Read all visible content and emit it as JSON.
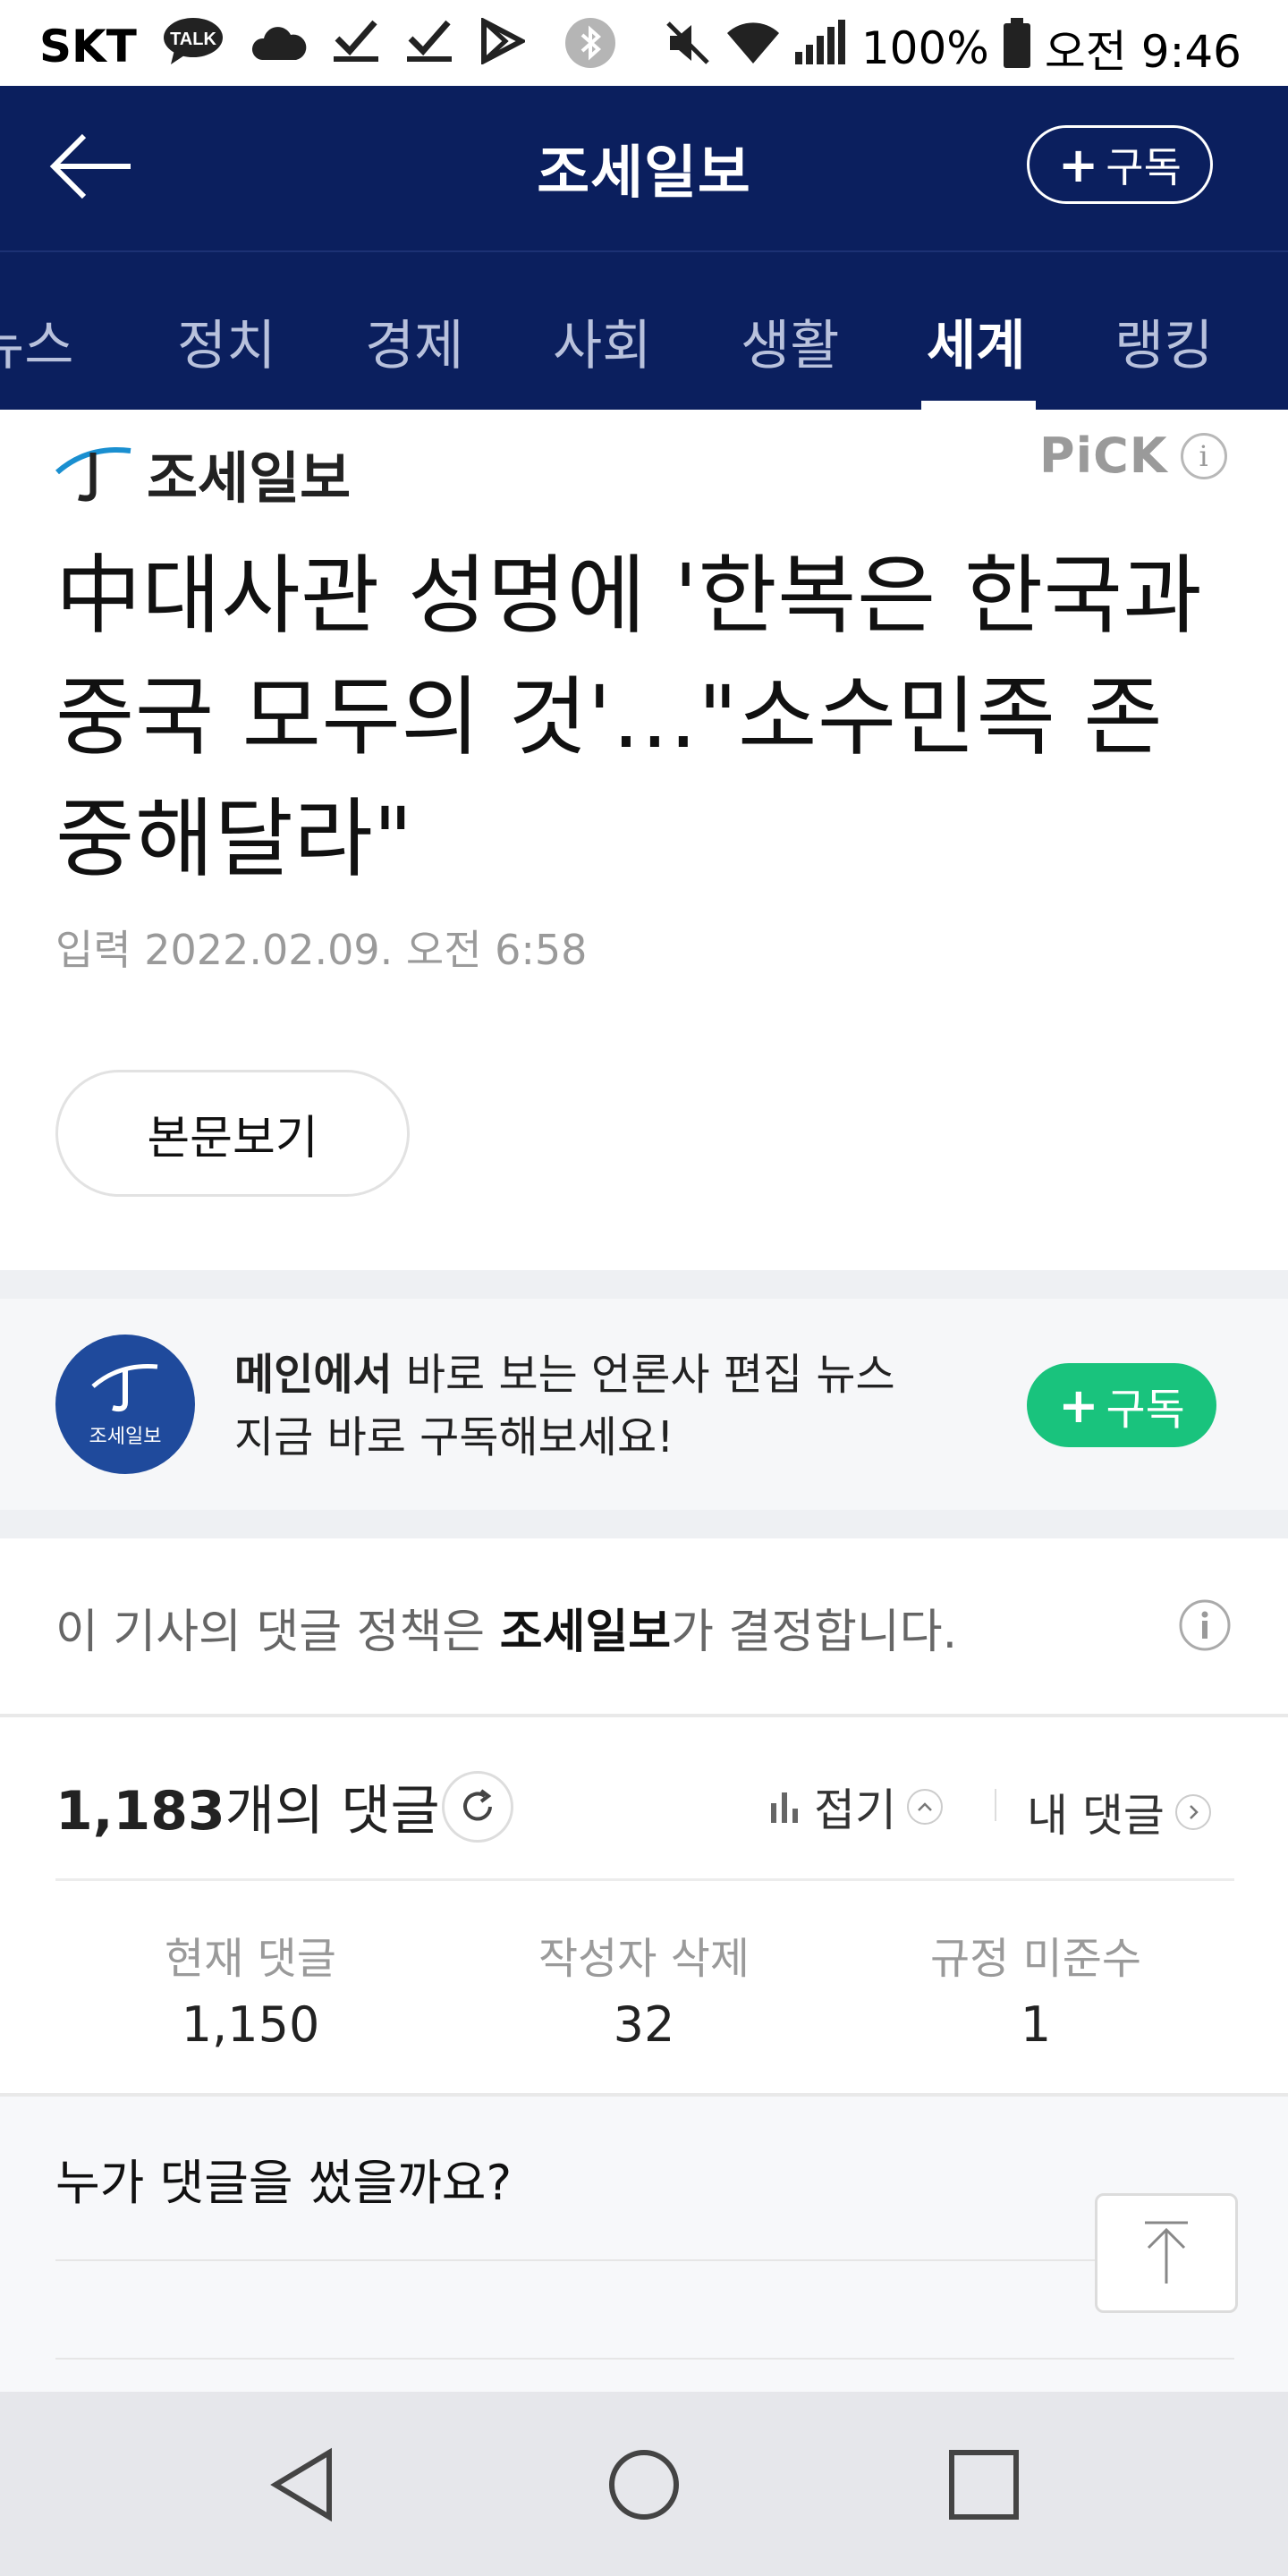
{
  "status_bar": {
    "carrier": "SKT",
    "talk_badge": "TALK",
    "battery": "100%",
    "time": "오전 9:46",
    "icons": [
      "kakaotalk-icon",
      "cloud-icon",
      "check-icon",
      "check-icon",
      "play-store-icon",
      "bluetooth-icon",
      "mute-icon",
      "wifi-icon",
      "signal-icon",
      "battery-icon"
    ]
  },
  "header": {
    "title": "조세일보",
    "subscribe_label": "구독",
    "back_icon": "arrow-left-icon"
  },
  "tabs": [
    {
      "label": "뉴스",
      "active": false
    },
    {
      "label": "정치",
      "active": false
    },
    {
      "label": "경제",
      "active": false
    },
    {
      "label": "사회",
      "active": false
    },
    {
      "label": "생활",
      "active": false
    },
    {
      "label": "세계",
      "active": true
    },
    {
      "label": "랭킹",
      "active": false
    }
  ],
  "article": {
    "press_name": "조세일보",
    "pick_label": "PiCK",
    "headline": "中대사관 성명에 '한복은 한국과 중국 모두의 것'…\"소수민족 존중해달라\"",
    "date": "입력 2022.02.09. 오전 6:58",
    "view_original": "본문보기"
  },
  "promo": {
    "logo_label": "조세일보",
    "text_bold": "메인에서",
    "text_line1_rest": " 바로 보는 언론사 편집 뉴스",
    "text_line2": "지금 바로 구독해보세요!",
    "button_label": "구독",
    "accent_color": "#19c37d"
  },
  "comment_policy": {
    "prefix": "이 기사의 댓글 정책은 ",
    "press": "조세일보",
    "suffix": "가 결정합니다."
  },
  "comments": {
    "count": "1,183",
    "count_suffix": "개의 댓글",
    "fold_label": "접기",
    "my_comments_label": "내 댓글",
    "stats": [
      {
        "label": "현재 댓글",
        "value": "1,150"
      },
      {
        "label": "작성자 삭제",
        "value": "32"
      },
      {
        "label": "규정 미준수",
        "value": "1"
      }
    ],
    "who_title": "누가 댓글을 썼을까요?"
  },
  "colors": {
    "header_bg": "#0b1f5e",
    "subscribe_green": "#19c37d"
  }
}
